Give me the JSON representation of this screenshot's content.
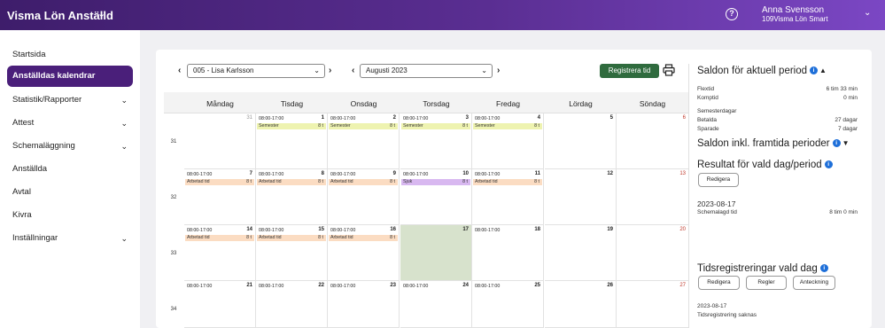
{
  "app": {
    "title": "Visma Lön Anställd",
    "user_name": "Anna Svensson",
    "user_company": "109Visma Lön Smart",
    "chevron_icon": "chevron-down-icon",
    "help_icon": "help-icon"
  },
  "sidebar": {
    "items": [
      {
        "label": "Startsida",
        "expandable": false
      },
      {
        "label": "Anställdas kalendrar",
        "expandable": false,
        "active": true
      },
      {
        "label": "Statistik/Rapporter",
        "expandable": true
      },
      {
        "label": "Attest",
        "expandable": true
      },
      {
        "label": "Schemaläggning",
        "expandable": true
      },
      {
        "label": "Anställda",
        "expandable": false
      },
      {
        "label": "Avtal",
        "expandable": false
      },
      {
        "label": "Kivra",
        "expandable": false
      },
      {
        "label": "Inställningar",
        "expandable": true
      }
    ]
  },
  "toolbar": {
    "employee_select": "005 - Lisa Karlsson",
    "month_select": "Augusti 2023",
    "register_label": "Registrera tid",
    "print_icon": "printer-icon"
  },
  "calendar": {
    "days": [
      "Måndag",
      "Tisdag",
      "Onsdag",
      "Torsdag",
      "Fredag",
      "Lördag",
      "Söndag"
    ],
    "weeks": [
      {
        "week": "31",
        "cells": [
          {
            "day": "31",
            "time": "",
            "tag": "",
            "hours": "",
            "kind": "",
            "num_style": "gray"
          },
          {
            "day": "1",
            "time": "08:00-17:00",
            "tag": "Semester",
            "hours": "8 t",
            "kind": "sem"
          },
          {
            "day": "2",
            "time": "08:00-17:00",
            "tag": "Semester",
            "hours": "8 t",
            "kind": "sem"
          },
          {
            "day": "3",
            "time": "08:00-17:00",
            "tag": "Semester",
            "hours": "8 t",
            "kind": "sem"
          },
          {
            "day": "4",
            "time": "08:00-17:00",
            "tag": "Semester",
            "hours": "8 t",
            "kind": "sem"
          },
          {
            "day": "5",
            "time": "",
            "tag": "",
            "hours": "",
            "kind": ""
          },
          {
            "day": "6",
            "time": "",
            "tag": "",
            "hours": "",
            "kind": "",
            "num_style": "red"
          }
        ]
      },
      {
        "week": "32",
        "cells": [
          {
            "day": "7",
            "time": "08:00-17:00",
            "tag": "Arbetad tid",
            "hours": "8 t",
            "kind": "arb"
          },
          {
            "day": "8",
            "time": "08:00-17:00",
            "tag": "Arbetad tid",
            "hours": "8 t",
            "kind": "arb"
          },
          {
            "day": "9",
            "time": "08:00-17:00",
            "tag": "Arbetad tid",
            "hours": "8 t",
            "kind": "arb"
          },
          {
            "day": "10",
            "time": "08:00-17:00",
            "tag": "Sjuk",
            "hours": "8 t",
            "kind": "sjuk"
          },
          {
            "day": "11",
            "time": "08:00-17:00",
            "tag": "Arbetad tid",
            "hours": "8 t",
            "kind": "arb"
          },
          {
            "day": "12",
            "time": "",
            "tag": "",
            "hours": "",
            "kind": ""
          },
          {
            "day": "13",
            "time": "",
            "tag": "",
            "hours": "",
            "kind": "",
            "num_style": "red"
          }
        ]
      },
      {
        "week": "33",
        "cells": [
          {
            "day": "14",
            "time": "08:00-17:00",
            "tag": "Arbetad tid",
            "hours": "8 t",
            "kind": "arb"
          },
          {
            "day": "15",
            "time": "08:00-17:00",
            "tag": "Arbetad tid",
            "hours": "8 t",
            "kind": "arb"
          },
          {
            "day": "16",
            "time": "08:00-17:00",
            "tag": "Arbetad tid",
            "hours": "8 t",
            "kind": "arb"
          },
          {
            "day": "17",
            "time": "",
            "tag": "",
            "hours": "",
            "kind": "",
            "selected": true
          },
          {
            "day": "18",
            "time": "08:00-17:00",
            "tag": "",
            "hours": "",
            "kind": ""
          },
          {
            "day": "19",
            "time": "",
            "tag": "",
            "hours": "",
            "kind": ""
          },
          {
            "day": "20",
            "time": "",
            "tag": "",
            "hours": "",
            "kind": "",
            "num_style": "red"
          }
        ]
      },
      {
        "week": "34",
        "cells": [
          {
            "day": "21",
            "time": "08:00-17:00",
            "tag": "",
            "hours": "",
            "kind": ""
          },
          {
            "day": "22",
            "time": "08:00-17:00",
            "tag": "",
            "hours": "",
            "kind": ""
          },
          {
            "day": "23",
            "time": "08:00-17:00",
            "tag": "",
            "hours": "",
            "kind": ""
          },
          {
            "day": "24",
            "time": "08:00-17:00",
            "tag": "",
            "hours": "",
            "kind": ""
          },
          {
            "day": "25",
            "time": "08:00-17:00",
            "tag": "",
            "hours": "",
            "kind": ""
          },
          {
            "day": "26",
            "time": "",
            "tag": "",
            "hours": "",
            "kind": ""
          },
          {
            "day": "27",
            "time": "",
            "tag": "",
            "hours": "",
            "kind": "",
            "num_style": "red"
          }
        ]
      }
    ]
  },
  "right": {
    "saldon_title": "Saldon för aktuell period",
    "flextid_label": "Flextid",
    "flextid_value": "6 tim 33 min",
    "komptid_label": "Komptid",
    "komptid_value": "0 min",
    "semester_label": "Semesterdagar",
    "betalda_label": "Betalda",
    "betalda_value": "27 dagar",
    "sparade_label": "Sparade",
    "sparade_value": "7 dagar",
    "saldon_framtida": "Saldon inkl. framtida perioder",
    "resultat_title": "Resultat för vald dag/period",
    "redigera": "Redigera",
    "date": "2023-08-17",
    "schema_label": "Schemalagd tid",
    "schema_value": "8 tim 0 min",
    "tidsreg_title": "Tidsregistreringar vald dag",
    "regler": "Regler",
    "anteckning": "Anteckning",
    "date2": "2023-08-17",
    "saknas": "Tidsregistrering saknas",
    "info_icon": "info-icon"
  }
}
